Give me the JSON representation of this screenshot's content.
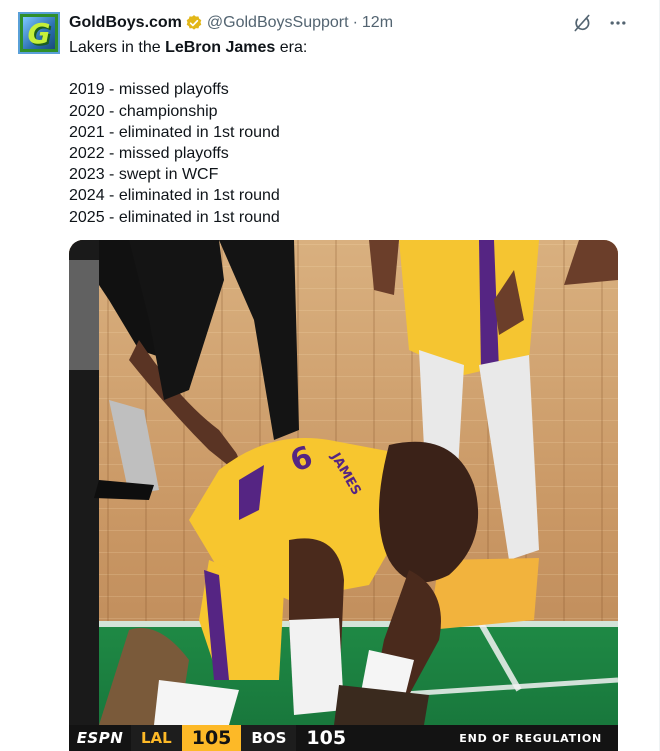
{
  "tweet": {
    "display_name": "GoldBoys.com",
    "handle": "@GoldBoysSupport",
    "separator": "·",
    "time": "12m",
    "avatar_letter": "G",
    "text_intro_prefix": "Lakers in the ",
    "text_intro_bold": "LeBron James",
    "text_intro_suffix": " era:",
    "lines": [
      "2019 - missed playoffs",
      "2020 - championship",
      "2021 - eliminated in 1st round",
      "2022 - missed playoffs",
      "2023 - swept in WCF",
      "2024 - eliminated in 1st round",
      "2025 - eliminated in 1st round"
    ]
  },
  "icons": {
    "verified": "verified-badge-icon",
    "grok": "grok-icon",
    "more": "more-icon"
  },
  "media": {
    "jersey_number": "6",
    "jersey_name": "JAMES",
    "scoreboard": {
      "network": "ESPN",
      "away_abbr": "LAL",
      "away_score": "105",
      "home_abbr": "BOS",
      "home_score": "105",
      "status": "END OF REGULATION"
    }
  },
  "colors": {
    "lakers_gold": "#fdb927",
    "lakers_purple": "#552583",
    "verified_gold": "#e2b719",
    "text_secondary": "#536471"
  }
}
